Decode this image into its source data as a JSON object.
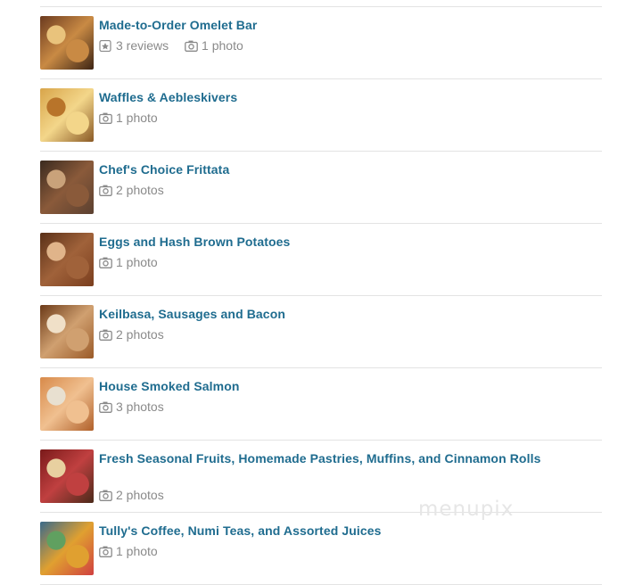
{
  "items": [
    {
      "title": "Made-to-Order Omelet Bar",
      "reviews": "3 reviews",
      "photos": "1 photo",
      "thumb_colors": [
        "#6b3a1f",
        "#c98a44",
        "#e9c37c",
        "#3d2414"
      ]
    },
    {
      "title": "Waffles & Aebleskivers",
      "reviews": null,
      "photos": "1 photo",
      "thumb_colors": [
        "#d8a54a",
        "#f3d68a",
        "#b8742a",
        "#8a5a25"
      ]
    },
    {
      "title": "Chef's Choice Frittata",
      "reviews": null,
      "photos": "2 photos",
      "thumb_colors": [
        "#3a2a1f",
        "#8a5a3a",
        "#c9a27a",
        "#5b4030"
      ]
    },
    {
      "title": "Eggs and Hash Brown Potatoes",
      "reviews": null,
      "photos": "1 photo",
      "thumb_colors": [
        "#5a3018",
        "#a0623a",
        "#e0b48a",
        "#7a3e1e"
      ]
    },
    {
      "title": "Keilbasa, Sausages and Bacon",
      "reviews": null,
      "photos": "2 photos",
      "thumb_colors": [
        "#6b3a18",
        "#d0a070",
        "#f0e0c8",
        "#9a5a28"
      ]
    },
    {
      "title": "House Smoked Salmon",
      "reviews": null,
      "photos": "3 photos",
      "thumb_colors": [
        "#d88a4a",
        "#f0c090",
        "#e8e0d0",
        "#b0602a"
      ]
    },
    {
      "title": "Fresh Seasonal Fruits, Homemade Pastries, Muffins, and Cinnamon Rolls",
      "reviews": null,
      "photos": "2 photos",
      "thumb_colors": [
        "#7a1a1a",
        "#c04040",
        "#e8d0a0",
        "#4a2a1a"
      ]
    },
    {
      "title": "Tully's Coffee, Numi Teas, and Assorted Juices",
      "reviews": null,
      "photos": "1 photo",
      "thumb_colors": [
        "#3a6a8a",
        "#e0a030",
        "#60a060",
        "#d04040"
      ]
    }
  ],
  "watermark": "menupix"
}
